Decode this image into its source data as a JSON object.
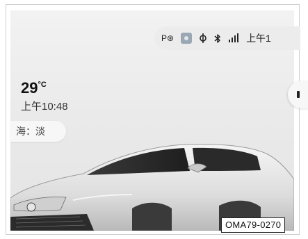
{
  "status_bar": {
    "park_brake_icon_text": "P⊛",
    "icons": [
      "park-brake-icon",
      "camera-icon",
      "wireless-charging-icon",
      "bluetooth-icon",
      "signal-icon"
    ],
    "time": "上午1"
  },
  "weather": {
    "temperature": "29",
    "unit": "°C",
    "clock": "上午10:48"
  },
  "air_quality": {
    "label": "海：淡"
  },
  "figure_code": "OMA79-0270",
  "colors": {
    "background": "#ececec",
    "car_body": "#e9e9e9",
    "text": "#222222"
  }
}
